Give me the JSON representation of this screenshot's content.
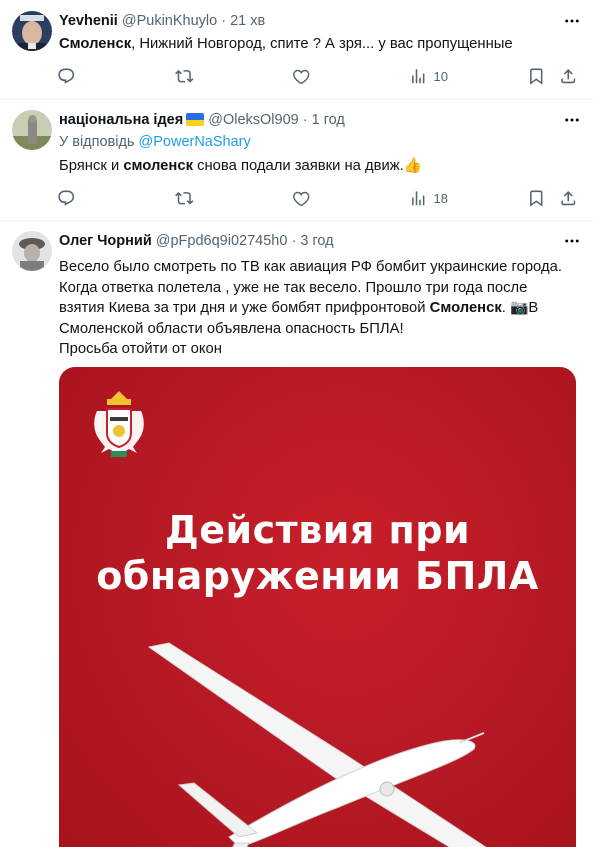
{
  "tweets": [
    {
      "name": "Yevhenii",
      "handle": "@PukinKhuylo",
      "time": "21 хв",
      "text_bold": "Смоленск",
      "text_rest": ", Нижний Новгород, спите ? А зря... у вас пропущенные",
      "views": "10"
    },
    {
      "name": "національна ідея",
      "handle": "@OleksOl909",
      "time": "1 год",
      "reply_prefix": "У відповідь ",
      "reply_to": "@PowerNaShary",
      "text_a": "Брянск и ",
      "text_bold": "смоленск",
      "text_b": " снова подали заявки на движ.👍",
      "views": "18"
    },
    {
      "name": "Олег Чорний",
      "handle": "@pFpd6q9i02745h0",
      "time": "3 год",
      "line1": "Весело было смотреть по ТВ как авиация РФ бомбит украинские города.",
      "line2": "Когда ответка полетела , уже не так весело. Прошло три года после",
      "line3_a": "взятия Киева за три дня и уже бомбят прифронтовой ",
      "line3_bold": "Смоленск",
      "line3_b": ". 📷В",
      "line4": "Смоленской области объявлена опасность БПЛА!",
      "line5": "Просьба отойти от окон",
      "media_line1": "Действия при",
      "media_line2": "обнаружении БПЛА"
    }
  ],
  "dot": "·",
  "colors": {
    "link": "#1d9bf0",
    "secondary": "#536471",
    "media_red": "#b81a25"
  },
  "icons": [
    "more-icon",
    "reply-icon",
    "retweet-icon",
    "like-icon",
    "views-icon",
    "bookmark-icon",
    "share-icon",
    "ukraine-flag-icon"
  ]
}
